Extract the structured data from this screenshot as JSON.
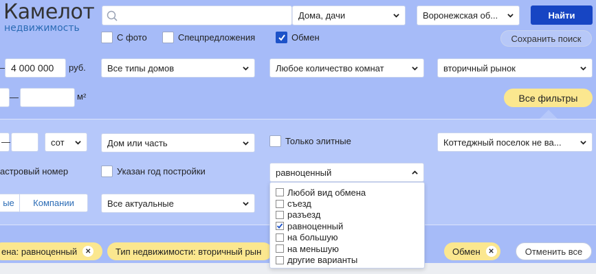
{
  "logo": {
    "title": "Камелот",
    "subtitle": "недвижимость"
  },
  "search": {
    "query": "",
    "category": "Дома, дачи",
    "region": "Воронежская об...",
    "find_label": "Найти"
  },
  "checks": {
    "photo": {
      "label": "С фото",
      "checked": false
    },
    "special": {
      "label": "Спецпредложения",
      "checked": false
    },
    "exchange": {
      "label": "Обмен",
      "checked": true
    }
  },
  "save_search_label": "Сохранить поиск",
  "price": {
    "dash": "–",
    "to": "4 000 000",
    "unit": "руб."
  },
  "house_types": "Все типы домов",
  "rooms": "Любое количество комнат",
  "market": "вторичный рынок",
  "area": {
    "dash": "—",
    "unit": "м²"
  },
  "all_filters_label": "Все фильтры",
  "land": {
    "dash": "—",
    "unit_select": "сот"
  },
  "house_or_part": "Дом или часть",
  "elite": {
    "label": "Только элитные",
    "checked": false
  },
  "cottage": "Коттеджный поселок не ва...",
  "cadastral_label": "астровый номер",
  "year_built": {
    "label": "Указан год постройки",
    "checked": false
  },
  "exchange_select": {
    "value": "равноценный",
    "options": [
      {
        "label": "Любой вид обмена",
        "checked": false
      },
      {
        "label": "съезд",
        "checked": false
      },
      {
        "label": "разъезд",
        "checked": false
      },
      {
        "label": "равноценный",
        "checked": true
      },
      {
        "label": "на большую",
        "checked": false
      },
      {
        "label": "на меньшую",
        "checked": false
      },
      {
        "label": "другие варианты",
        "checked": false
      }
    ]
  },
  "seller_seg": {
    "left": "ые",
    "right": "Компании"
  },
  "actuality": "Все актуальные",
  "tags": [
    {
      "label": "ена: равноценный"
    },
    {
      "label": "Тип недвижимости: вторичный рын"
    },
    {
      "label": "Обмен"
    }
  ],
  "reset_label": "Отменить все"
}
